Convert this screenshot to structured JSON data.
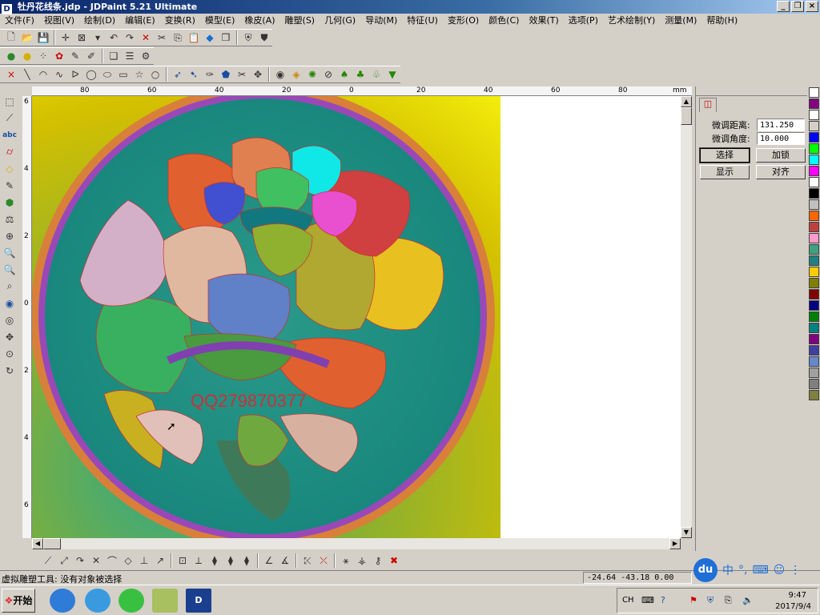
{
  "window": {
    "title": "牡丹花线条.jdp - JDPaint 5.21 Ultimate",
    "app_icon": "D"
  },
  "menu": [
    "文件(F)",
    "视图(V)",
    "绘制(D)",
    "编辑(E)",
    "变换(R)",
    "模型(E)",
    "橡皮(A)",
    "雕塑(S)",
    "几何(G)",
    "导动(M)",
    "特征(U)",
    "变形(O)",
    "颜色(C)",
    "效果(T)",
    "选项(P)",
    "艺术绘制(Y)",
    "测量(M)",
    "帮助(H)"
  ],
  "ruler": {
    "top_labels": [
      "80",
      "60",
      "40",
      "20",
      "0",
      "20",
      "40",
      "60",
      "80"
    ],
    "unit": "mm",
    "left_labels": [
      "6",
      "4",
      "2",
      "0",
      "2",
      "4",
      "6"
    ]
  },
  "canvas": {
    "watermark": "QQ279870377"
  },
  "panel": {
    "distance_label": "微调距离:",
    "distance_value": "131.250",
    "angle_label": "微调角度:",
    "angle_value": "10.000",
    "btn_select": "选择",
    "btn_lock": "加锁",
    "btn_show": "显示",
    "btn_align": "对齐"
  },
  "palette": [
    "#ffffff",
    "#800080",
    "#ffffff",
    "#d4d0c8",
    "#0000ff",
    "#00ff00",
    "#00ffff",
    "#ff00ff",
    "#ffffff",
    "#000000",
    "#c0c0c0",
    "#ff6600",
    "#c04040",
    "#ff99cc",
    "#40a080",
    "#208080",
    "#ffcc00",
    "#808000",
    "#800000",
    "#000080",
    "#008000",
    "#008080",
    "#800080",
    "#4040a0",
    "#6688cc",
    "#a0a0a0",
    "#808080",
    "#808040"
  ],
  "status": {
    "text": "虚拟雕塑工具: 没有对象被选择",
    "coords": "-24.64 -43.18 0.00"
  },
  "taskbar": {
    "start": "开始",
    "lang": "CH",
    "time": "9:47",
    "date": "2017/9/4"
  },
  "ime": {
    "logo": "du",
    "mode": "中"
  }
}
